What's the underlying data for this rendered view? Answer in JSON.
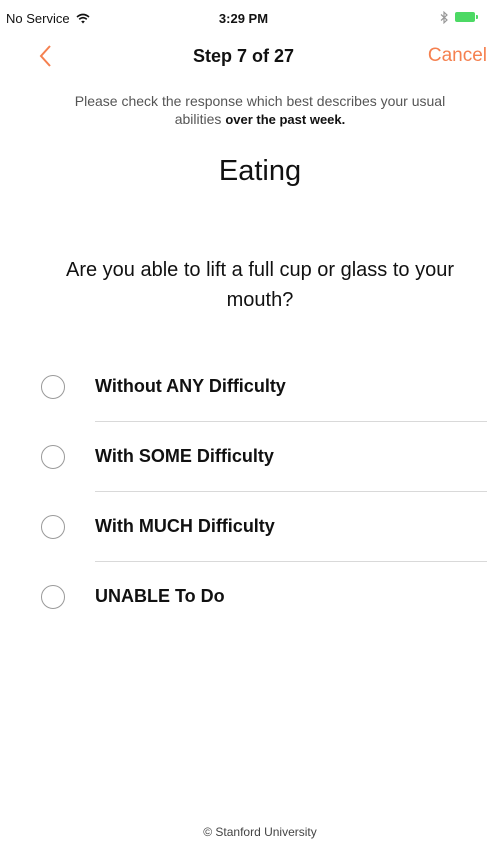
{
  "status_bar": {
    "carrier": "No Service",
    "time": "3:29 PM",
    "icons": [
      "wifi-icon",
      "bluetooth-icon",
      "battery-icon"
    ],
    "battery_color": "#4cd964"
  },
  "nav": {
    "back_icon": "chevron-left-icon",
    "title": "Step 7 of 27",
    "cancel_label": "Cancel",
    "accent_color": "#f5804f"
  },
  "instruction": {
    "text": "Please check the response which best describes your usual abilities",
    "emphasis": "over the past week."
  },
  "section_title": "Eating",
  "question": "Are you able to lift a full cup or glass to your mouth?",
  "options": [
    {
      "label": "Without ANY Difficulty",
      "selected": false
    },
    {
      "label": "With SOME Difficulty",
      "selected": false
    },
    {
      "label": "With MUCH Difficulty",
      "selected": false
    },
    {
      "label": "UNABLE To Do",
      "selected": false
    }
  ],
  "footer": "© Stanford University"
}
